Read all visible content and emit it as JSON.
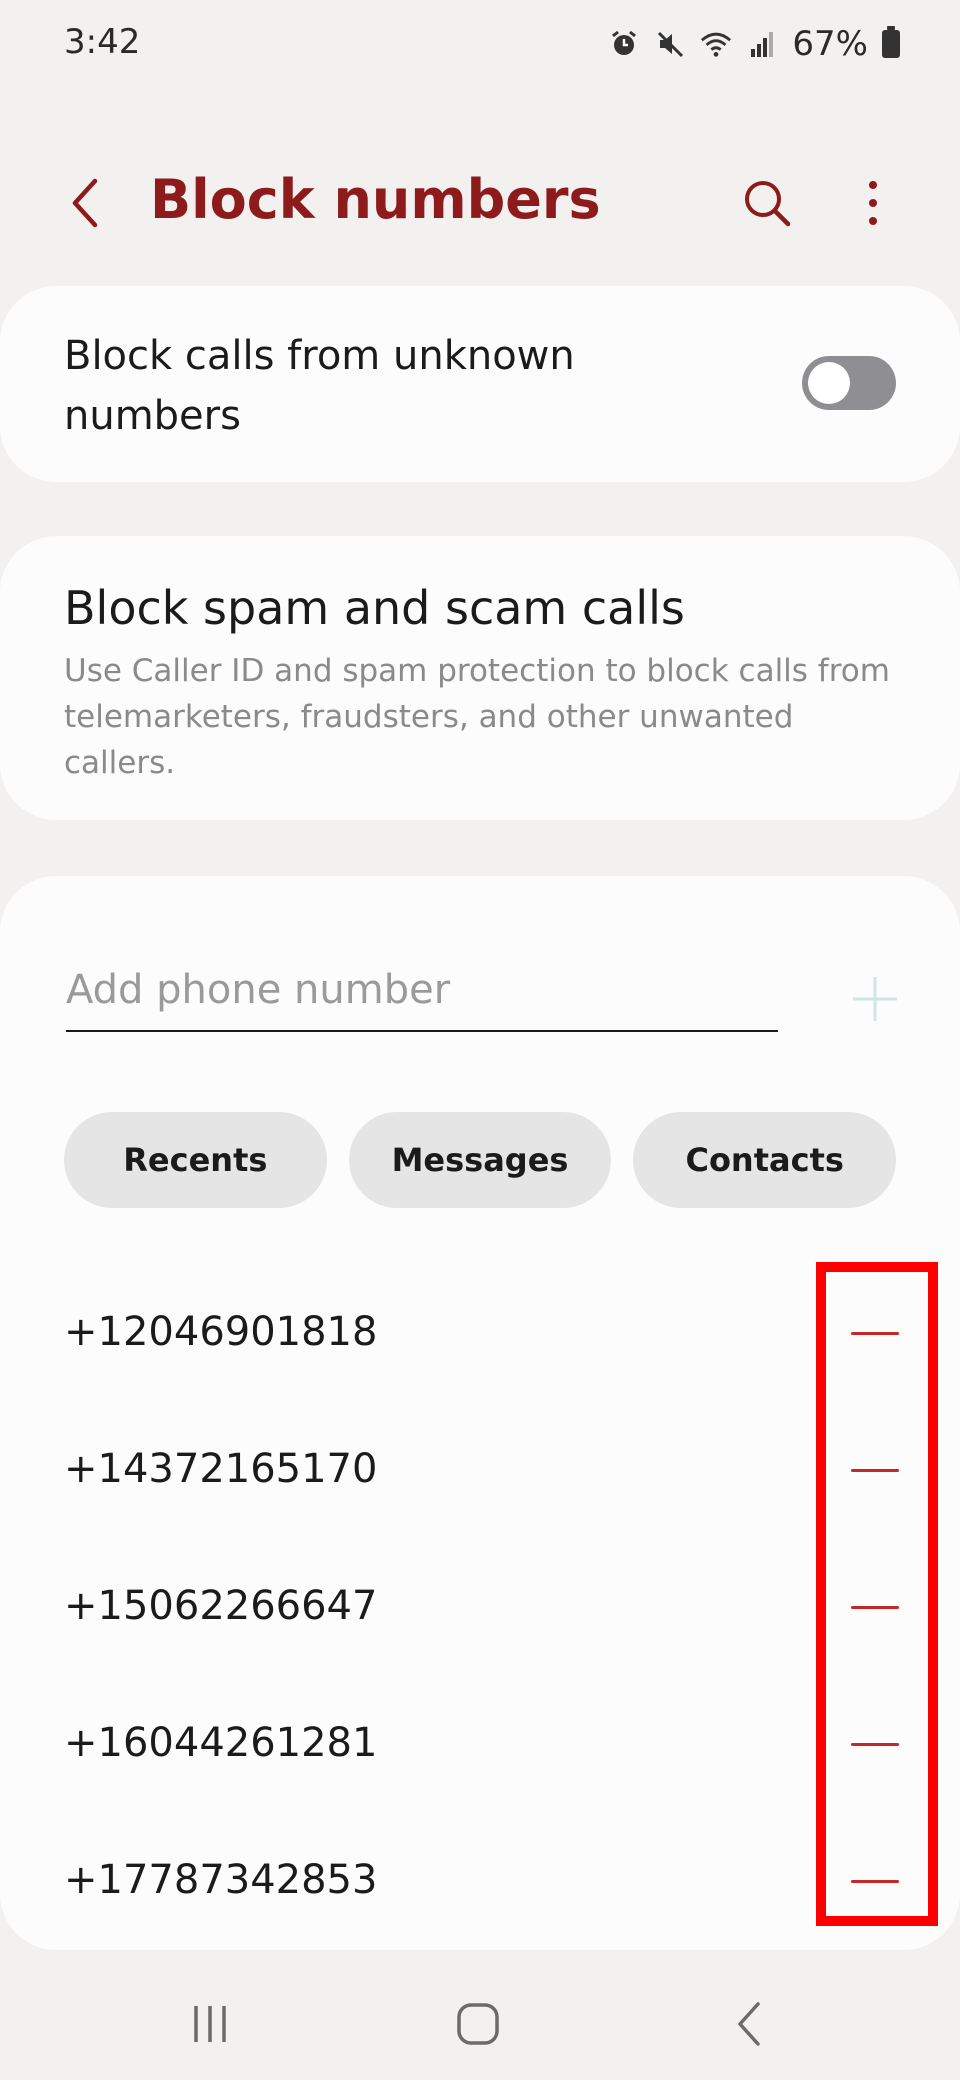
{
  "status_bar": {
    "time": "3:42",
    "battery": "67%",
    "icons": [
      "alarm-icon",
      "mute-icon",
      "wifi-icon",
      "signal-icon",
      "battery-icon"
    ]
  },
  "app_bar": {
    "title": "Block numbers",
    "icons": [
      "back-icon",
      "search-icon",
      "more-options-icon"
    ]
  },
  "unknown_numbers": {
    "label": "Block calls from unknown numbers",
    "enabled": false
  },
  "spam": {
    "title": "Block spam and scam calls",
    "description": "Use Caller ID and spam protection to block calls from telemarketers, fraudsters, and other unwanted callers."
  },
  "add_number": {
    "placeholder": "Add phone number",
    "value": ""
  },
  "sources": {
    "recents": "Recents",
    "messages": "Messages",
    "contacts": "Contacts"
  },
  "blocked_numbers": [
    "+12046901818",
    "+14372165170",
    "+15062266647",
    "+16044261281",
    "+17787342853"
  ],
  "colors": {
    "accent": "#8e1b1b",
    "remove": "#c62828",
    "highlight": "#ff0000",
    "background": "#f3f0f0",
    "card": "#fcfcfc"
  }
}
